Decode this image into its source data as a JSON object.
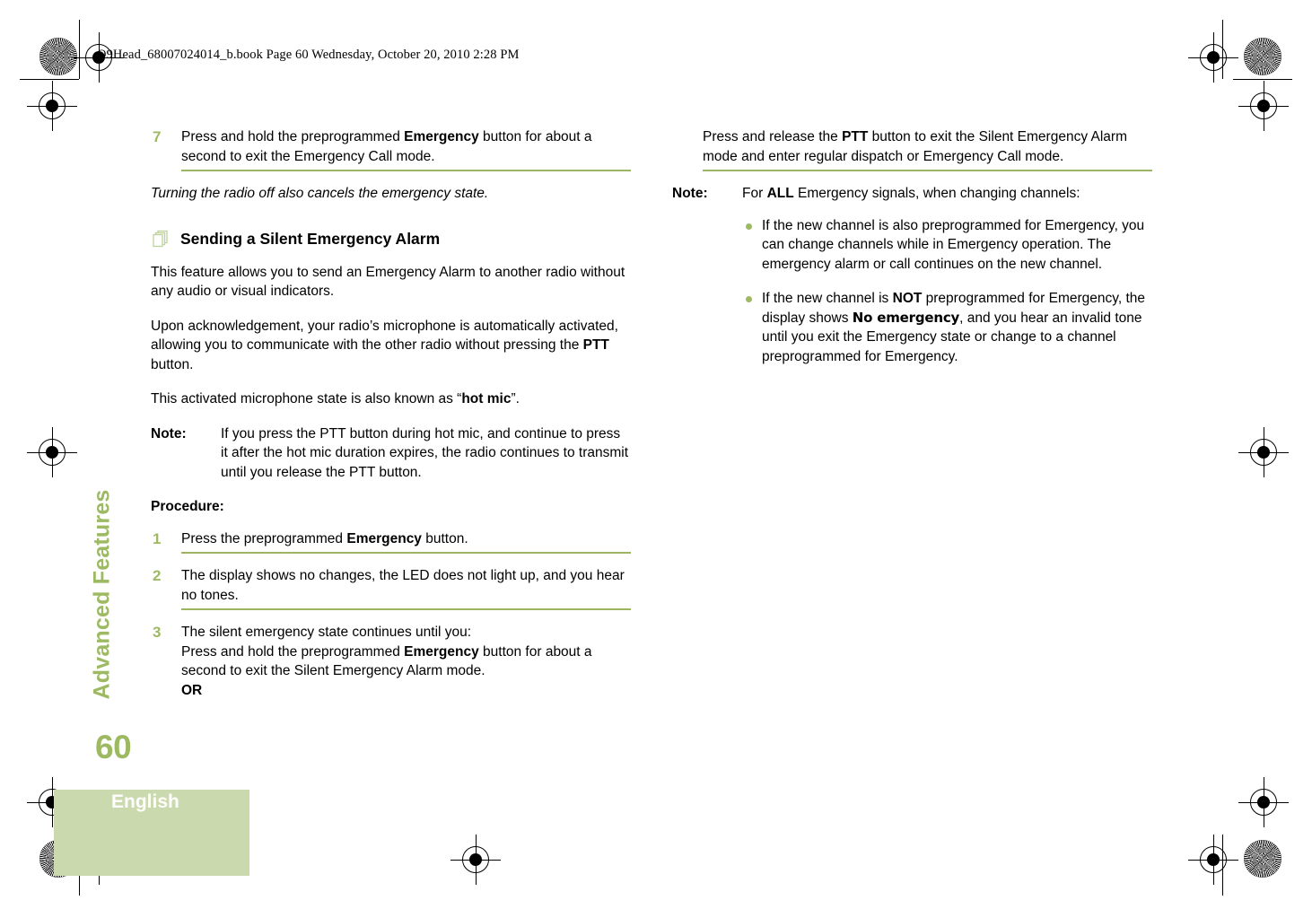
{
  "document": {
    "header_line": "O9Head_68007024014_b.book  Page 60  Wednesday, October 20, 2010  2:28 PM",
    "chapter_tab": "Advanced Features",
    "page_number": "60",
    "language_label": "English",
    "accent_green": "#9DBA63",
    "rule_green": "#9BB563",
    "band_green": "#CBD9AE"
  },
  "left_column": {
    "step7": {
      "number": "7",
      "text_before_bold": "Press and hold the preprogrammed ",
      "bold": "Emergency",
      "text_after_bold": " button for about a second to exit the Emergency Call mode."
    },
    "italic_note": "Turning the radio off also cancels the emergency state.",
    "section_heading": "Sending a Silent Emergency Alarm",
    "section_icon": "stacked-pages-icon",
    "para1": "This feature allows you to send an Emergency Alarm to another radio without any audio or visual indicators.",
    "para2_before": "Upon acknowledgement, your radio’s microphone is automatically activated, allowing you to communicate with the other radio without pressing the ",
    "para2_bold": "PTT",
    "para2_after": " button.",
    "para3_before": "This activated microphone state is also known as “",
    "para3_bold": "hot mic",
    "para3_after": "”.",
    "note": {
      "label": "Note:",
      "text": "If you press the PTT button during hot mic, and continue to press it after the hot mic duration expires, the radio continues to transmit until you release the PTT button."
    },
    "procedure_label": "Procedure:",
    "step1": {
      "number": "1",
      "text_before_bold": "Press the preprogrammed ",
      "bold": "Emergency",
      "text_after_bold": " button."
    },
    "step2": {
      "number": "2",
      "text": "The display shows no changes, the LED does not light up, and you hear no tones."
    },
    "step3": {
      "number": "3",
      "line1": "The silent emergency state continues until you:",
      "line2_before": "Press and hold the preprogrammed ",
      "line2_bold": "Emergency",
      "line2_after": " button for about a second to exit the Silent Emergency Alarm mode.",
      "or": "OR"
    }
  },
  "right_column": {
    "continuation": {
      "before_bold": "Press and release the ",
      "bold": "PTT",
      "after_bold": " button to exit the Silent Emergency Alarm mode and enter regular dispatch or Emergency Call mode."
    },
    "note": {
      "label": "Note:",
      "before_bold": "For ",
      "bold": "ALL",
      "after_bold": " Emergency signals, when changing channels:"
    },
    "bullet1": "If the new channel is also preprogrammed for Emergency, you can change channels while in Emergency operation. The emergency alarm or call continues on the new channel.",
    "bullet2": {
      "part1": "If the new channel is ",
      "bold1": "NOT",
      "part2": " preprogrammed for Emergency, the display shows ",
      "lcd": "No emergency",
      "part3": ", and you hear an invalid tone until you exit the Emergency state or change to a channel preprogrammed for Emergency."
    }
  }
}
